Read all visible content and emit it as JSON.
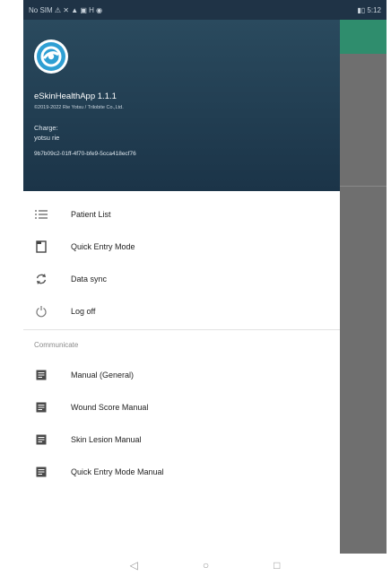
{
  "status_bar": {
    "left_text": "No SIM ⚠ ✕ ▲ ▣ H ◉",
    "right_text": "▮▯ 5:12"
  },
  "drawer": {
    "header": {
      "app_name": "eSkinHealthApp 1.1.1",
      "copyright": "©2019-2022 Rie Yotsu / Trilobite Co.,Ltd.",
      "charge_label": "Charge:",
      "charge_user": "yotsu rie",
      "device_id": "9b7b09c2-01ff-4f70-bfe9-5cca418ecf76"
    },
    "menu": [
      {
        "label": "Patient List",
        "icon": "list-icon"
      },
      {
        "label": "Quick Entry Mode",
        "icon": "document-icon"
      },
      {
        "label": "Data sync",
        "icon": "sync-icon"
      },
      {
        "label": "Log off",
        "icon": "power-icon"
      }
    ],
    "communicate": {
      "section_label": "Communicate",
      "items": [
        {
          "label": "Manual (General)",
          "icon": "manual-icon"
        },
        {
          "label": "Wound Score Manual",
          "icon": "manual-icon"
        },
        {
          "label": "Skin Lesion Manual",
          "icon": "manual-icon"
        },
        {
          "label": "Quick Entry Mode Manual",
          "icon": "manual-icon"
        }
      ]
    }
  },
  "colors": {
    "header_bg": "#1b3448",
    "app_bar": "#2f8d6d",
    "logo_accent": "#2f9fd3"
  },
  "nav_bar": {
    "back": "◁",
    "home": "○",
    "recents": "□"
  }
}
